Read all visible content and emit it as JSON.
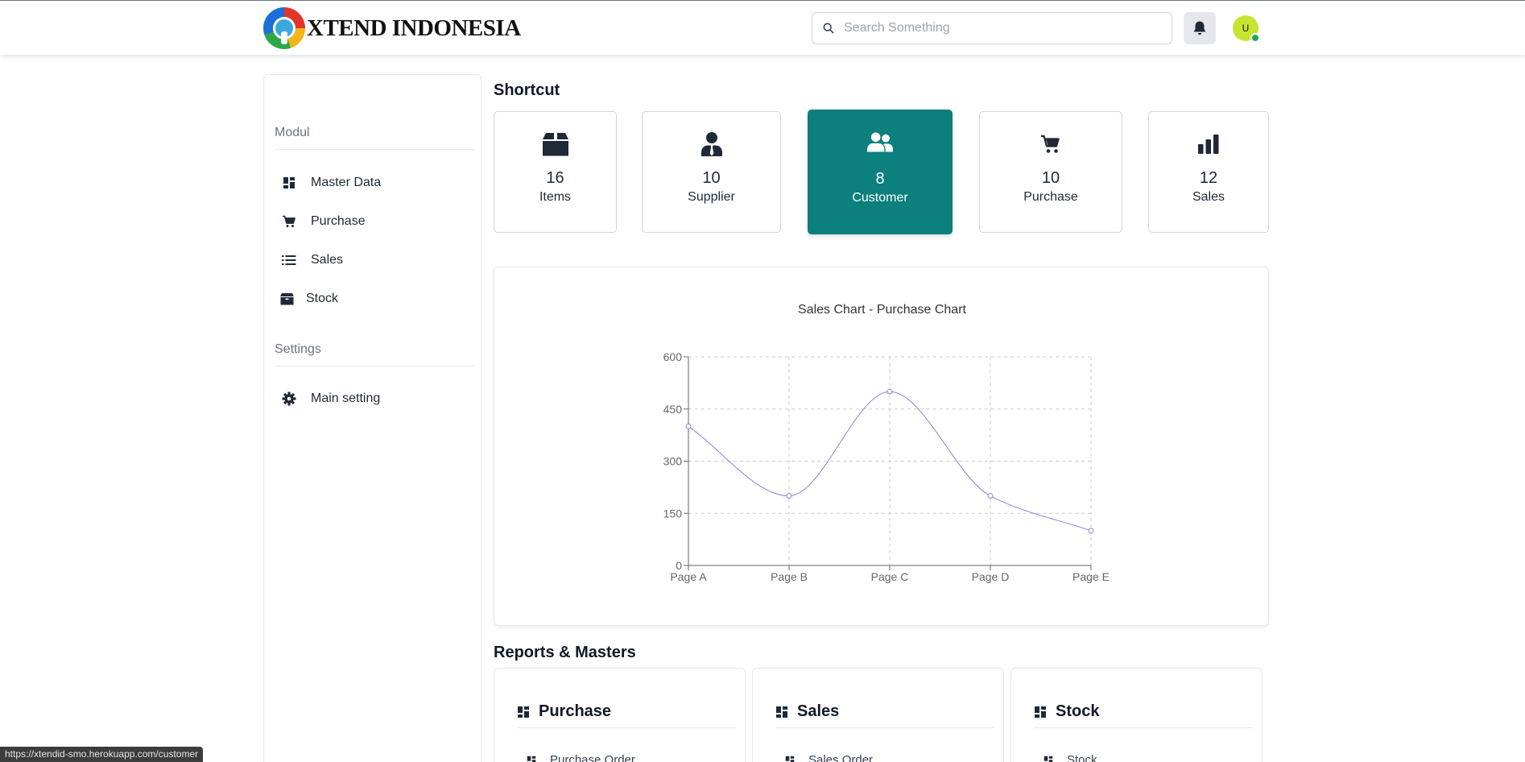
{
  "header": {
    "brand": "XTEND INDONESIA",
    "search_placeholder": "Search Something",
    "avatar_initial": "U"
  },
  "sidebar": {
    "sections": [
      {
        "title": "Modul",
        "items": [
          {
            "label": "Master Data",
            "icon": "dashboard-icon"
          },
          {
            "label": "Purchase",
            "icon": "cart-icon"
          },
          {
            "label": "Sales",
            "icon": "list-icon"
          },
          {
            "label": "Stock",
            "icon": "box-icon"
          }
        ]
      },
      {
        "title": "Settings",
        "items": [
          {
            "label": "Main setting",
            "icon": "gear-icon"
          }
        ]
      }
    ]
  },
  "shortcut": {
    "title": "Shortcut",
    "cards": [
      {
        "count": "16",
        "label": "Items",
        "icon": "box-icon"
      },
      {
        "count": "10",
        "label": "Supplier",
        "icon": "user-tie-icon"
      },
      {
        "count": "8",
        "label": "Customer",
        "icon": "users-icon",
        "active": true
      },
      {
        "count": "10",
        "label": "Purchase",
        "icon": "cart-icon"
      },
      {
        "count": "12",
        "label": "Sales",
        "icon": "bar-chart-icon"
      }
    ],
    "active_color": "#0b807c"
  },
  "chart_data": {
    "type": "line",
    "title": "Sales Chart - Purchase Chart",
    "categories": [
      "Page A",
      "Page B",
      "Page C",
      "Page D",
      "Page E"
    ],
    "series": [
      {
        "values": [
          400,
          200,
          500,
          200,
          100
        ],
        "color": "#8884d8"
      }
    ],
    "ylim": [
      0,
      600
    ],
    "yticks": [
      "0",
      "150",
      "300",
      "450",
      "600"
    ],
    "grid": true,
    "curve": "monotone"
  },
  "reports": {
    "title": "Reports & Masters",
    "cards": [
      {
        "title": "Purchase",
        "first_item": "Purchase Order"
      },
      {
        "title": "Sales",
        "first_item": "Sales Order"
      },
      {
        "title": "Stock",
        "first_item": "Stock"
      }
    ]
  },
  "status_url": "https://xtendid-smo.herokuapp.com/customer"
}
